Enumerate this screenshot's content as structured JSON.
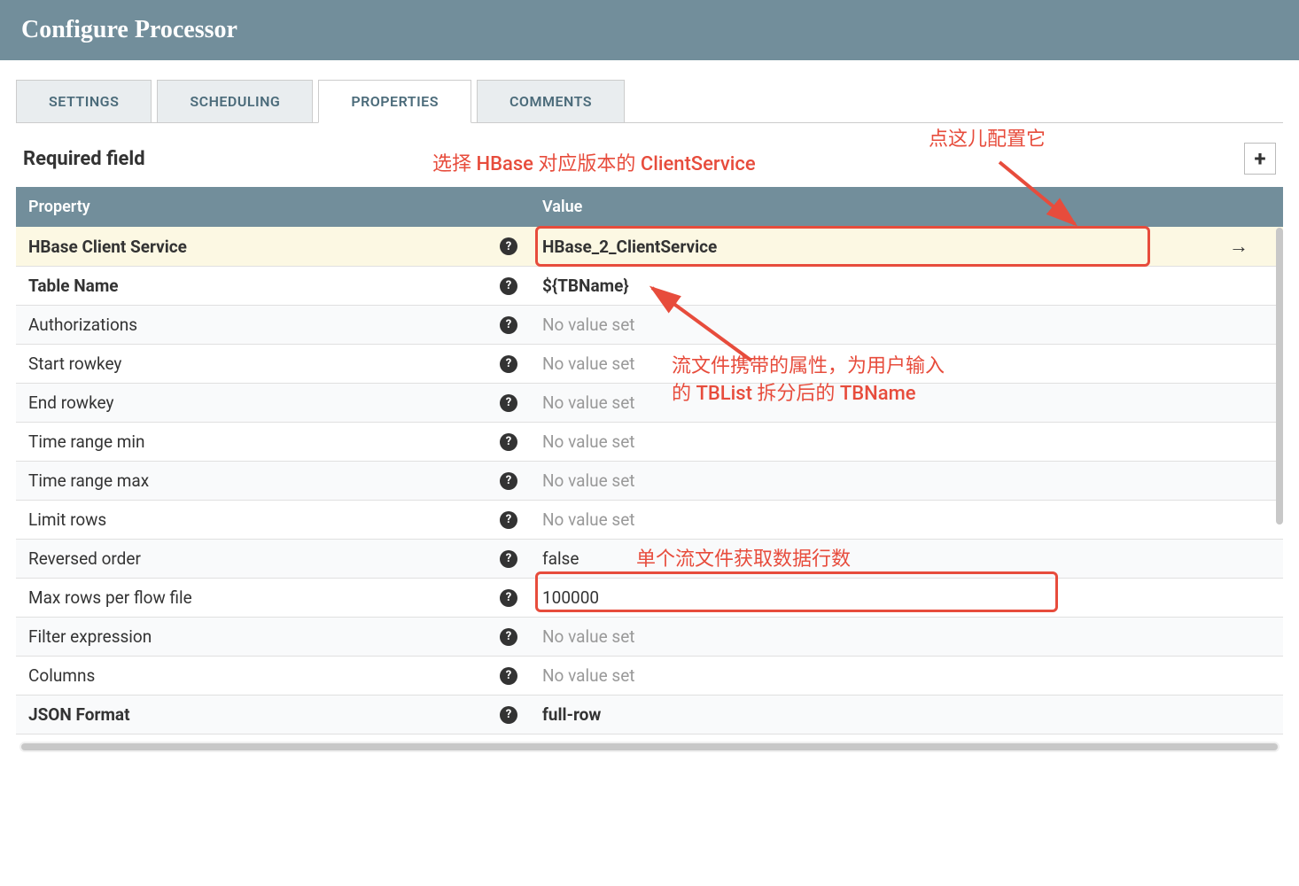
{
  "header": {
    "title": "Configure Processor"
  },
  "tabs": {
    "settings": "SETTINGS",
    "scheduling": "SCHEDULING",
    "properties": "PROPERTIES",
    "comments": "COMMENTS"
  },
  "required_label": "Required field",
  "columns": {
    "property": "Property",
    "value": "Value"
  },
  "rows": [
    {
      "name": "HBase Client Service",
      "bold": true,
      "value": "HBase_2_ClientService",
      "value_bold": true,
      "no_value": false,
      "highlight": true,
      "action": "goto"
    },
    {
      "name": "Table Name",
      "bold": true,
      "value": "${TBName}",
      "value_bold": true,
      "no_value": false
    },
    {
      "name": "Authorizations",
      "bold": false,
      "value": "No value set",
      "no_value": true
    },
    {
      "name": "Start rowkey",
      "bold": false,
      "value": "No value set",
      "no_value": true
    },
    {
      "name": "End rowkey",
      "bold": false,
      "value": "No value set",
      "no_value": true
    },
    {
      "name": "Time range min",
      "bold": false,
      "value": "No value set",
      "no_value": true
    },
    {
      "name": "Time range max",
      "bold": false,
      "value": "No value set",
      "no_value": true
    },
    {
      "name": "Limit rows",
      "bold": false,
      "value": "No value set",
      "no_value": true
    },
    {
      "name": "Reversed order",
      "bold": false,
      "value": "false",
      "no_value": false
    },
    {
      "name": "Max rows per flow file",
      "bold": false,
      "value": "100000",
      "no_value": false
    },
    {
      "name": "Filter expression",
      "bold": false,
      "value": "No value set",
      "no_value": true
    },
    {
      "name": "Columns",
      "bold": false,
      "value": "No value set",
      "no_value": true
    },
    {
      "name": "JSON Format",
      "bold": true,
      "value": "full-row",
      "value_bold": true,
      "no_value": false
    }
  ],
  "annotations": {
    "a1": "选择 HBase 对应版本的 ClientService",
    "a2": "点这儿配置它",
    "a3_line1": "流文件携带的属性，为用户输入",
    "a3_line2": "的 TBList 拆分后的 TBName",
    "a4": "单个流文件获取数据行数"
  }
}
